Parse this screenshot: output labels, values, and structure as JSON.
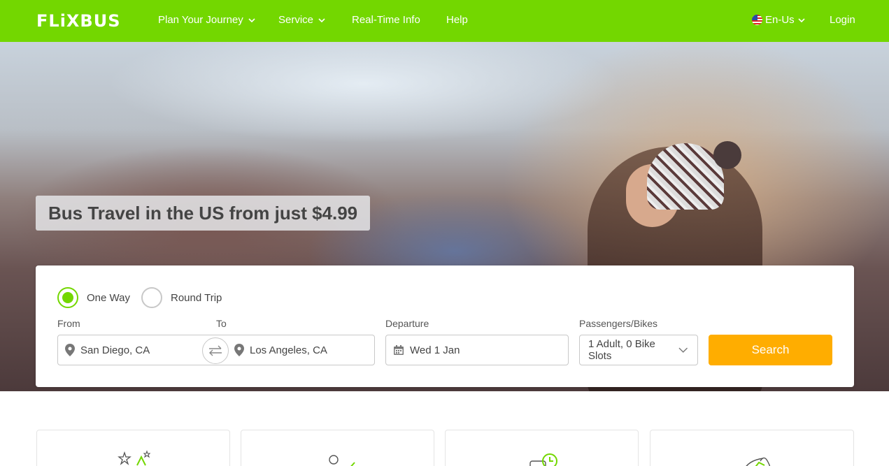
{
  "brand": {
    "logo_text": "FLiXBUS",
    "accent_color": "#73d700",
    "cta_color": "#ffad00"
  },
  "nav": {
    "items": [
      {
        "label": "Plan Your Journey",
        "has_dropdown": true
      },
      {
        "label": "Service",
        "has_dropdown": true
      },
      {
        "label": "Real-Time Info",
        "has_dropdown": false
      },
      {
        "label": "Help",
        "has_dropdown": false
      }
    ],
    "language": {
      "label": "En-Us",
      "icon": "us-flag-icon"
    },
    "login_label": "Login"
  },
  "hero": {
    "headline": "Bus Travel in the US from just $4.99"
  },
  "search": {
    "trip_types": [
      {
        "label": "One Way",
        "selected": true
      },
      {
        "label": "Round Trip",
        "selected": false
      }
    ],
    "from_label": "From",
    "from_value": "San Diego, CA",
    "to_label": "To",
    "to_value": "Los Angeles, CA",
    "departure_label": "Departure",
    "departure_value": "Wed 1 Jan",
    "passengers_label": "Passengers/Bikes",
    "passengers_value": "1 Adult, 0 Bike Slots",
    "search_label": "Search"
  },
  "features": {
    "cards": [
      {
        "icon": "stars-icon"
      },
      {
        "icon": "person-check-icon"
      },
      {
        "icon": "bus-clock-icon"
      },
      {
        "icon": "leaf-icon"
      }
    ]
  }
}
